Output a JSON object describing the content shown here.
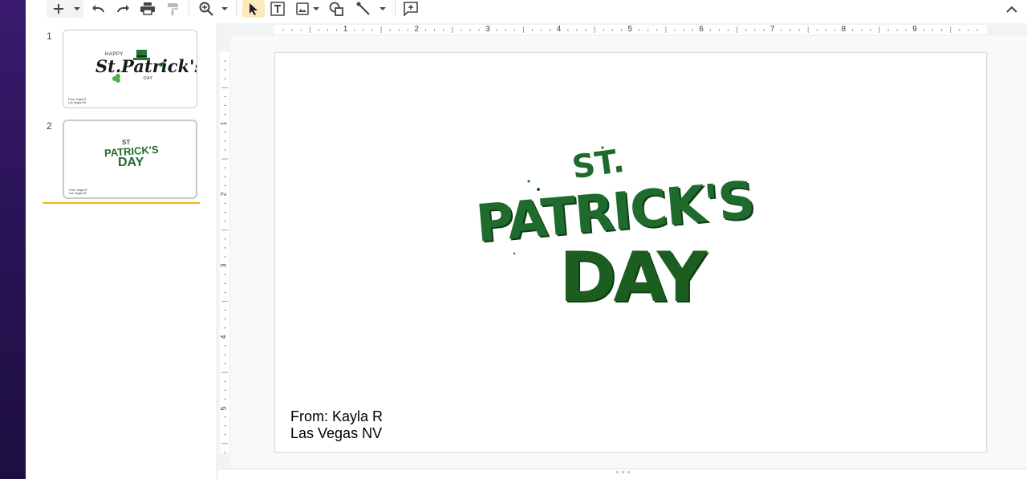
{
  "toolbar": {
    "tools": [
      {
        "name": "new-slide-button",
        "icon": "plus-icon"
      },
      {
        "name": "new-slide-dropdown",
        "icon": "chevron-down-icon"
      },
      {
        "name": "undo-button",
        "icon": "undo-icon"
      },
      {
        "name": "redo-button",
        "icon": "redo-icon"
      },
      {
        "name": "print-button",
        "icon": "print-icon"
      },
      {
        "name": "paint-format-button",
        "icon": "paint-roller-icon"
      },
      {
        "name": "zoom-button",
        "icon": "zoom-icon"
      },
      {
        "name": "select-tool",
        "icon": "cursor-icon"
      },
      {
        "name": "text-box-tool",
        "icon": "text-box-icon"
      },
      {
        "name": "insert-image-tool",
        "icon": "image-icon"
      },
      {
        "name": "shape-tool",
        "icon": "shape-icon"
      },
      {
        "name": "line-tool",
        "icon": "line-icon"
      },
      {
        "name": "add-comment-button",
        "icon": "comment-add-icon"
      },
      {
        "name": "collapse-menus-button",
        "icon": "chevron-up-icon"
      }
    ]
  },
  "filmstrip": {
    "slides": [
      {
        "number": "1",
        "title_small": "HAPPY",
        "title_script": "St.Patrick's",
        "title_day": "DAY",
        "footer_line1": "From: Kayla R",
        "footer_line2": "Las Vegas NV"
      },
      {
        "number": "2",
        "title_line1": "ST",
        "title_line2": "PATRICK'S",
        "title_line3": "DAY",
        "footer_line1": "From: Kayla R",
        "footer_line2": "Las Vegas NV"
      }
    ]
  },
  "ruler": {
    "h_labels": [
      "1",
      "2",
      "3",
      "4",
      "5",
      "6",
      "7",
      "8",
      "9"
    ],
    "v_labels": [
      "1",
      "2",
      "3",
      "4",
      "5"
    ]
  },
  "slide": {
    "art_line1": "ST.",
    "art_line2": "PATRICK'S",
    "art_line3": "DAY",
    "from_line": "From: Kayla R",
    "location_line": "Las Vegas NV"
  },
  "colors": {
    "accent_selected": "#fde9b9",
    "film_marker": "#f4b400",
    "shamrock_green": "#1f6b2e"
  }
}
